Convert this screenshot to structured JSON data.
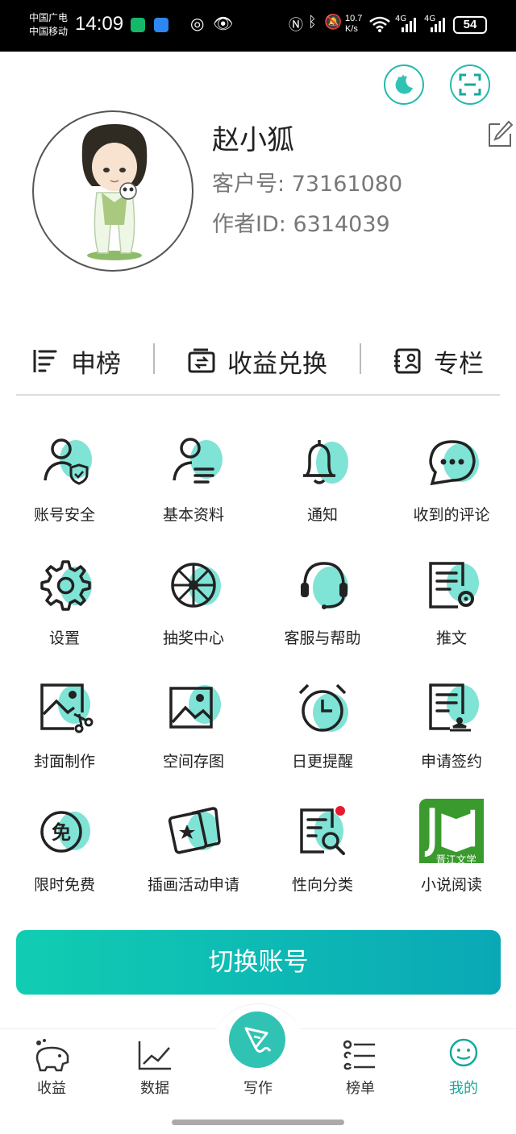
{
  "status_bar": {
    "carrier1": "中国广电",
    "carrier2": "中国移动",
    "time": "14:09",
    "netspeed_value": "10.7",
    "netspeed_unit": "K/s",
    "signal1": "4G",
    "signal2": "4G",
    "battery": "54"
  },
  "profile": {
    "nickname": "赵小狐",
    "customer_label": "客户号:",
    "customer_id": "73161080",
    "author_label": "作者ID:",
    "author_id": "6314039"
  },
  "quick_actions": [
    {
      "label": "申榜",
      "icon": "ranking-icon"
    },
    {
      "label": "收益兑换",
      "icon": "wallet-exchange-icon"
    },
    {
      "label": "专栏",
      "icon": "column-profile-icon"
    }
  ],
  "grid": [
    {
      "label": "账号安全",
      "icon": "user-shield-icon"
    },
    {
      "label": "基本资料",
      "icon": "user-info-icon"
    },
    {
      "label": "通知",
      "icon": "bell-icon"
    },
    {
      "label": "收到的评论",
      "icon": "comment-bubble-icon"
    },
    {
      "label": "设置",
      "icon": "gear-icon"
    },
    {
      "label": "抽奖中心",
      "icon": "wheel-icon"
    },
    {
      "label": "客服与帮助",
      "icon": "headset-icon"
    },
    {
      "label": "推文",
      "icon": "doc-gear-icon"
    },
    {
      "label": "封面制作",
      "icon": "image-scissors-icon"
    },
    {
      "label": "空间存图",
      "icon": "picture-icon"
    },
    {
      "label": "日更提醒",
      "icon": "alarm-clock-icon"
    },
    {
      "label": "申请签约",
      "icon": "contract-icon"
    },
    {
      "label": "限时免费",
      "icon": "free-badge-icon"
    },
    {
      "label": "插画活动申请",
      "icon": "cards-star-icon"
    },
    {
      "label": "性向分类",
      "icon": "doc-search-icon"
    },
    {
      "label": "小说阅读",
      "icon": "jjwxc-app-icon"
    }
  ],
  "jjwxc_logo_text": "晋江文学",
  "free_char": "免",
  "switch_account": "切换账号",
  "nav": [
    {
      "label": "收益",
      "icon": "piggy-bank-icon"
    },
    {
      "label": "数据",
      "icon": "line-chart-icon"
    },
    {
      "label": "写作",
      "icon": "write-pen-icon"
    },
    {
      "label": "榜单",
      "icon": "list-icon"
    },
    {
      "label": "我的",
      "icon": "smiley-icon"
    }
  ],
  "colors": {
    "accent": "#30c3b4",
    "accent_light": "#7fe3d6",
    "active_nav": "#17a99c",
    "notification_dot": "#e8192c"
  }
}
